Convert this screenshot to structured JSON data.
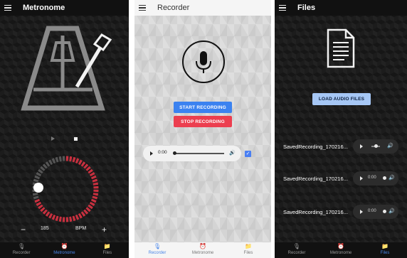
{
  "metronome_screen": {
    "title": "Metronome",
    "bpm_value": "185",
    "bpm_unit": "BPM",
    "minus_label": "−",
    "plus_label": "+"
  },
  "recorder_screen": {
    "title": "Recorder",
    "start_label": "START RECORDING",
    "stop_label": "STOP RECORDING",
    "player_time": "0:00",
    "checkbox_mark": "✓"
  },
  "files_screen": {
    "title": "Files",
    "load_label": "LOAD AUDIO FILES",
    "files": [
      {
        "name": "SavedRecording_170216...",
        "time": ""
      },
      {
        "name": "SavedRecording_170216...",
        "time": "0:00"
      },
      {
        "name": "SavedRecording_170216...",
        "time": "0:00"
      }
    ]
  },
  "nav": {
    "recorder": "Recorder",
    "metronome": "Metronome",
    "files": "Files"
  },
  "colors": {
    "accent_blue": "#3b82f0",
    "stop_red": "#ec3e4f",
    "dial_red": "#c8303f",
    "nav_active": "#4a86e8"
  },
  "icons": {
    "menu": "hamburger-icon",
    "mic": "microphone-icon",
    "metronome": "metronome-icon",
    "folder": "folder-icon",
    "document": "document-icon",
    "volume": "volume-icon"
  }
}
